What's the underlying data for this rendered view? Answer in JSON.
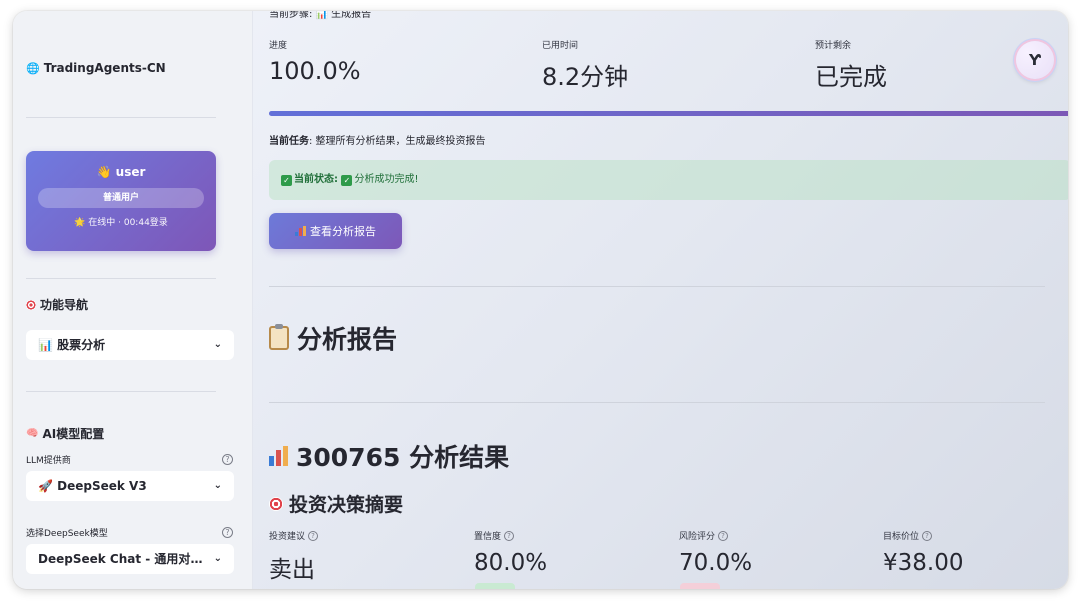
{
  "sidebar": {
    "app_title": "TradingAgents-CN",
    "user": {
      "name": "👋 user",
      "role": "普通用户",
      "status": "🌟 在线中 · 00:44登录"
    },
    "nav_title": "功能导航",
    "nav_selected": "📊 股票分析",
    "ai_config_title": "AI模型配置",
    "llm_provider_label": "LLM提供商",
    "llm_provider_value": "🚀 DeepSeek V3",
    "model_label": "选择DeepSeek模型",
    "model_value": "DeepSeek Chat - 通用对话模型"
  },
  "main": {
    "current_step_cut": "当前步骤: 📊 生成报告",
    "metrics": [
      {
        "label": "进度",
        "value": "100.0%"
      },
      {
        "label": "已用时间",
        "value": "8.2分钟"
      },
      {
        "label": "预计剩余",
        "value": "已完成"
      }
    ],
    "progress": 1.0,
    "task_label": "当前任务",
    "task_text": ": 整理所有分析结果，生成最终投资报告",
    "status_label": "当前状态",
    "status_text": "分析成功完成!",
    "view_report_button": "查看分析报告",
    "report_heading": "分析报告",
    "result_heading": "300765 分析结果",
    "summary_heading": "投资决策摘要",
    "summary": [
      {
        "label": "投资建议",
        "value": "卖出"
      },
      {
        "label": "置信度",
        "value": "80.0%"
      },
      {
        "label": "风险评分",
        "value": "70.0%"
      },
      {
        "label": "目标价位",
        "value": "¥38.00"
      }
    ]
  },
  "colors": {
    "accent_start": "#6d7ad9",
    "accent_end": "#7d58b8",
    "success_text": "#21703a",
    "success_bg": "#d6ebdc"
  }
}
